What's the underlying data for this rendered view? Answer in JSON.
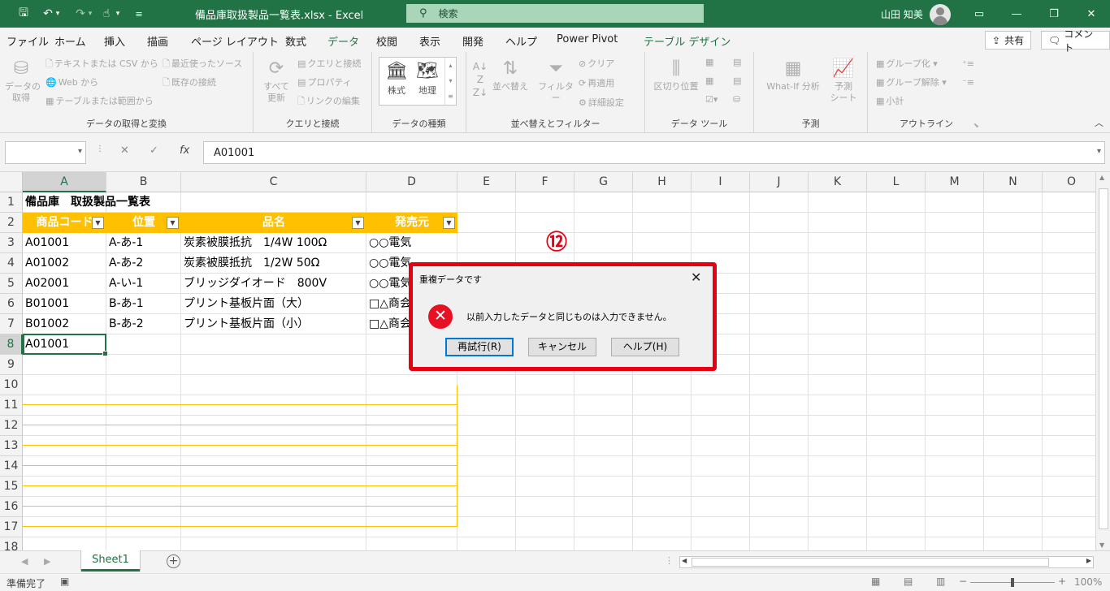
{
  "titlebar": {
    "doc_title": "備品庫取扱製品一覧表.xlsx  -  Excel",
    "search_placeholder": "検索",
    "user_name": "山田 知美"
  },
  "menu": {
    "tabs": [
      "ファイル",
      "ホーム",
      "挿入",
      "描画",
      "ページ レイアウト",
      "数式",
      "データ",
      "校閲",
      "表示",
      "開発",
      "ヘルプ",
      "Power Pivot",
      "テーブル デザイン"
    ],
    "active_tab": "データ",
    "share_label": "共有",
    "comment_label": "コメント"
  },
  "ribbon": {
    "get_data": {
      "label": "データの取得と変換",
      "big": "データの\n取得",
      "items": [
        "テキストまたは CSV から",
        "Web から",
        "テーブルまたは範囲から",
        "最近使ったソース",
        "既存の接続"
      ]
    },
    "queries": {
      "label": "クエリと接続",
      "big": "すべて\n更新",
      "items": [
        "クエリと接続",
        "プロパティ",
        "リンクの編集"
      ]
    },
    "data_types": {
      "label": "データの種類",
      "items": [
        "株式",
        "地理"
      ]
    },
    "sort_filter": {
      "label": "並べ替えとフィルター",
      "sort": "並べ替え",
      "filter": "フィルター",
      "items": [
        "クリア",
        "再適用",
        "詳細設定"
      ]
    },
    "data_tools": {
      "label": "データ ツール",
      "big": "区切り位置"
    },
    "forecast": {
      "label": "予測",
      "whatif": "What-If 分析",
      "sheet": "予測\nシート"
    },
    "outline": {
      "label": "アウトライン",
      "items": [
        "グループ化",
        "グループ解除",
        "小計"
      ]
    }
  },
  "formula_bar": {
    "name_box": "",
    "value": "A01001",
    "fx": "fx"
  },
  "grid": {
    "columns": [
      "A",
      "B",
      "C",
      "D",
      "E",
      "F",
      "G",
      "H",
      "I",
      "J",
      "K",
      "L",
      "M",
      "N",
      "O"
    ],
    "rows": [
      "1",
      "2",
      "3",
      "4",
      "5",
      "6",
      "7",
      "8",
      "9",
      "10",
      "11",
      "12",
      "13",
      "14",
      "15",
      "16",
      "17",
      "18"
    ],
    "title": "備品庫　取扱製品一覧表",
    "headers": [
      "商品コード",
      "位置",
      "品名",
      "発売元"
    ],
    "data": [
      [
        "A01001",
        "A-あ-1",
        "炭素被膜抵抗　1/4W 100Ω",
        "○○電気"
      ],
      [
        "A01002",
        "A-あ-2",
        "炭素被膜抵抗　1/2W 50Ω",
        "○○電気"
      ],
      [
        "A02001",
        "A-い-1",
        "ブリッジダイオード　800V",
        "○○電気"
      ],
      [
        "B01001",
        "B-あ-1",
        "プリント基板片面（大）",
        "□△商会"
      ],
      [
        "B01002",
        "B-あ-2",
        "プリント基板片面（小）",
        "□△商会"
      ]
    ],
    "input_cell": "A01001"
  },
  "sheet_tab": "Sheet1",
  "status": {
    "text": "準備完了",
    "zoom": "100%"
  },
  "annotation": "⑫",
  "dialog": {
    "title": "重複データです",
    "message": "以前入力したデータと同じものは入力できません。",
    "buttons": [
      "再試行(R)",
      "キャンセル",
      "ヘルプ(H)"
    ]
  },
  "colors": {
    "excel_green": "#217346",
    "table_header": "#ffc000",
    "highlight_red": "#e60012",
    "error_red": "#e81123"
  }
}
